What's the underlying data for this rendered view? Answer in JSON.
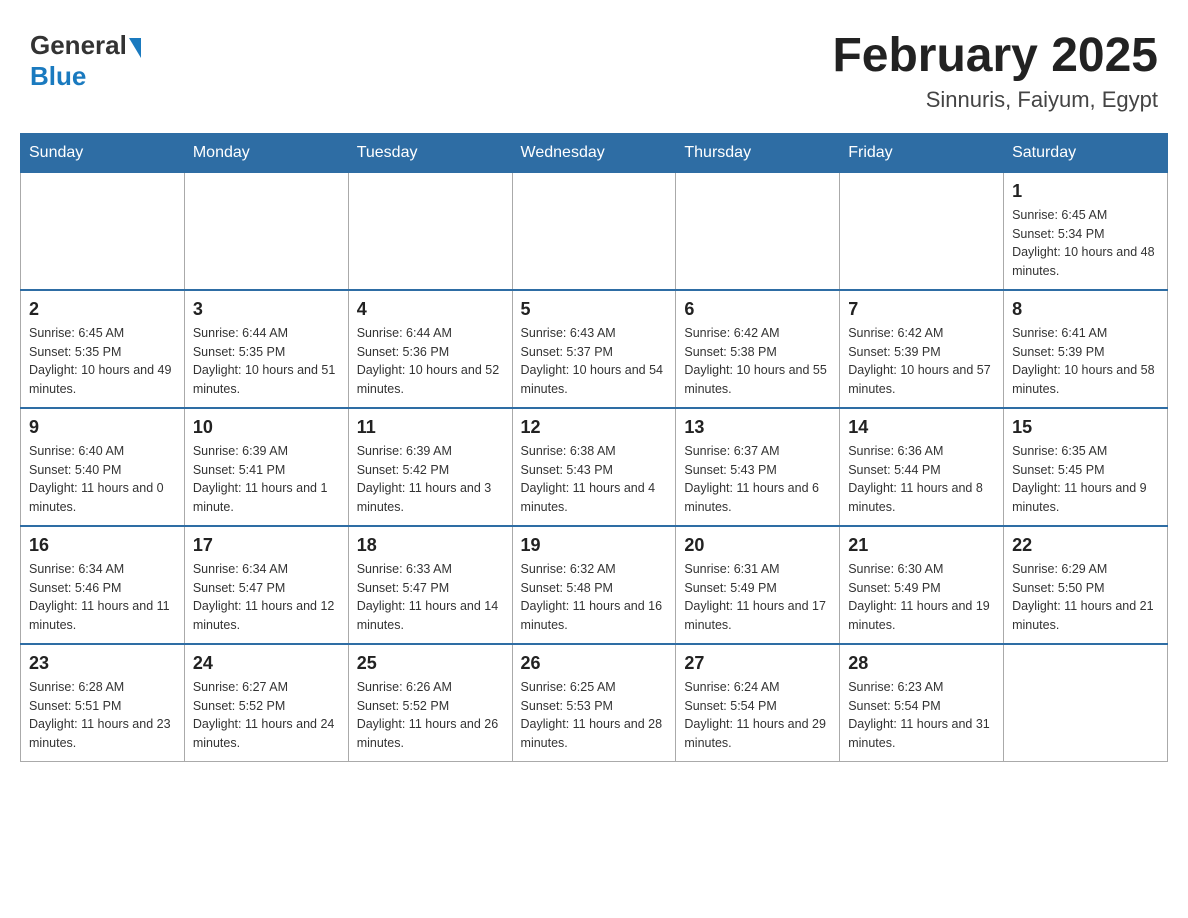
{
  "header": {
    "logo_general": "General",
    "logo_blue": "Blue",
    "month_title": "February 2025",
    "location": "Sinnuris, Faiyum, Egypt"
  },
  "days_of_week": [
    "Sunday",
    "Monday",
    "Tuesday",
    "Wednesday",
    "Thursday",
    "Friday",
    "Saturday"
  ],
  "weeks": [
    [
      {
        "day": "",
        "info": ""
      },
      {
        "day": "",
        "info": ""
      },
      {
        "day": "",
        "info": ""
      },
      {
        "day": "",
        "info": ""
      },
      {
        "day": "",
        "info": ""
      },
      {
        "day": "",
        "info": ""
      },
      {
        "day": "1",
        "info": "Sunrise: 6:45 AM\nSunset: 5:34 PM\nDaylight: 10 hours and 48 minutes."
      }
    ],
    [
      {
        "day": "2",
        "info": "Sunrise: 6:45 AM\nSunset: 5:35 PM\nDaylight: 10 hours and 49 minutes."
      },
      {
        "day": "3",
        "info": "Sunrise: 6:44 AM\nSunset: 5:35 PM\nDaylight: 10 hours and 51 minutes."
      },
      {
        "day": "4",
        "info": "Sunrise: 6:44 AM\nSunset: 5:36 PM\nDaylight: 10 hours and 52 minutes."
      },
      {
        "day": "5",
        "info": "Sunrise: 6:43 AM\nSunset: 5:37 PM\nDaylight: 10 hours and 54 minutes."
      },
      {
        "day": "6",
        "info": "Sunrise: 6:42 AM\nSunset: 5:38 PM\nDaylight: 10 hours and 55 minutes."
      },
      {
        "day": "7",
        "info": "Sunrise: 6:42 AM\nSunset: 5:39 PM\nDaylight: 10 hours and 57 minutes."
      },
      {
        "day": "8",
        "info": "Sunrise: 6:41 AM\nSunset: 5:39 PM\nDaylight: 10 hours and 58 minutes."
      }
    ],
    [
      {
        "day": "9",
        "info": "Sunrise: 6:40 AM\nSunset: 5:40 PM\nDaylight: 11 hours and 0 minutes."
      },
      {
        "day": "10",
        "info": "Sunrise: 6:39 AM\nSunset: 5:41 PM\nDaylight: 11 hours and 1 minute."
      },
      {
        "day": "11",
        "info": "Sunrise: 6:39 AM\nSunset: 5:42 PM\nDaylight: 11 hours and 3 minutes."
      },
      {
        "day": "12",
        "info": "Sunrise: 6:38 AM\nSunset: 5:43 PM\nDaylight: 11 hours and 4 minutes."
      },
      {
        "day": "13",
        "info": "Sunrise: 6:37 AM\nSunset: 5:43 PM\nDaylight: 11 hours and 6 minutes."
      },
      {
        "day": "14",
        "info": "Sunrise: 6:36 AM\nSunset: 5:44 PM\nDaylight: 11 hours and 8 minutes."
      },
      {
        "day": "15",
        "info": "Sunrise: 6:35 AM\nSunset: 5:45 PM\nDaylight: 11 hours and 9 minutes."
      }
    ],
    [
      {
        "day": "16",
        "info": "Sunrise: 6:34 AM\nSunset: 5:46 PM\nDaylight: 11 hours and 11 minutes."
      },
      {
        "day": "17",
        "info": "Sunrise: 6:34 AM\nSunset: 5:47 PM\nDaylight: 11 hours and 12 minutes."
      },
      {
        "day": "18",
        "info": "Sunrise: 6:33 AM\nSunset: 5:47 PM\nDaylight: 11 hours and 14 minutes."
      },
      {
        "day": "19",
        "info": "Sunrise: 6:32 AM\nSunset: 5:48 PM\nDaylight: 11 hours and 16 minutes."
      },
      {
        "day": "20",
        "info": "Sunrise: 6:31 AM\nSunset: 5:49 PM\nDaylight: 11 hours and 17 minutes."
      },
      {
        "day": "21",
        "info": "Sunrise: 6:30 AM\nSunset: 5:49 PM\nDaylight: 11 hours and 19 minutes."
      },
      {
        "day": "22",
        "info": "Sunrise: 6:29 AM\nSunset: 5:50 PM\nDaylight: 11 hours and 21 minutes."
      }
    ],
    [
      {
        "day": "23",
        "info": "Sunrise: 6:28 AM\nSunset: 5:51 PM\nDaylight: 11 hours and 23 minutes."
      },
      {
        "day": "24",
        "info": "Sunrise: 6:27 AM\nSunset: 5:52 PM\nDaylight: 11 hours and 24 minutes."
      },
      {
        "day": "25",
        "info": "Sunrise: 6:26 AM\nSunset: 5:52 PM\nDaylight: 11 hours and 26 minutes."
      },
      {
        "day": "26",
        "info": "Sunrise: 6:25 AM\nSunset: 5:53 PM\nDaylight: 11 hours and 28 minutes."
      },
      {
        "day": "27",
        "info": "Sunrise: 6:24 AM\nSunset: 5:54 PM\nDaylight: 11 hours and 29 minutes."
      },
      {
        "day": "28",
        "info": "Sunrise: 6:23 AM\nSunset: 5:54 PM\nDaylight: 11 hours and 31 minutes."
      },
      {
        "day": "",
        "info": ""
      }
    ]
  ]
}
